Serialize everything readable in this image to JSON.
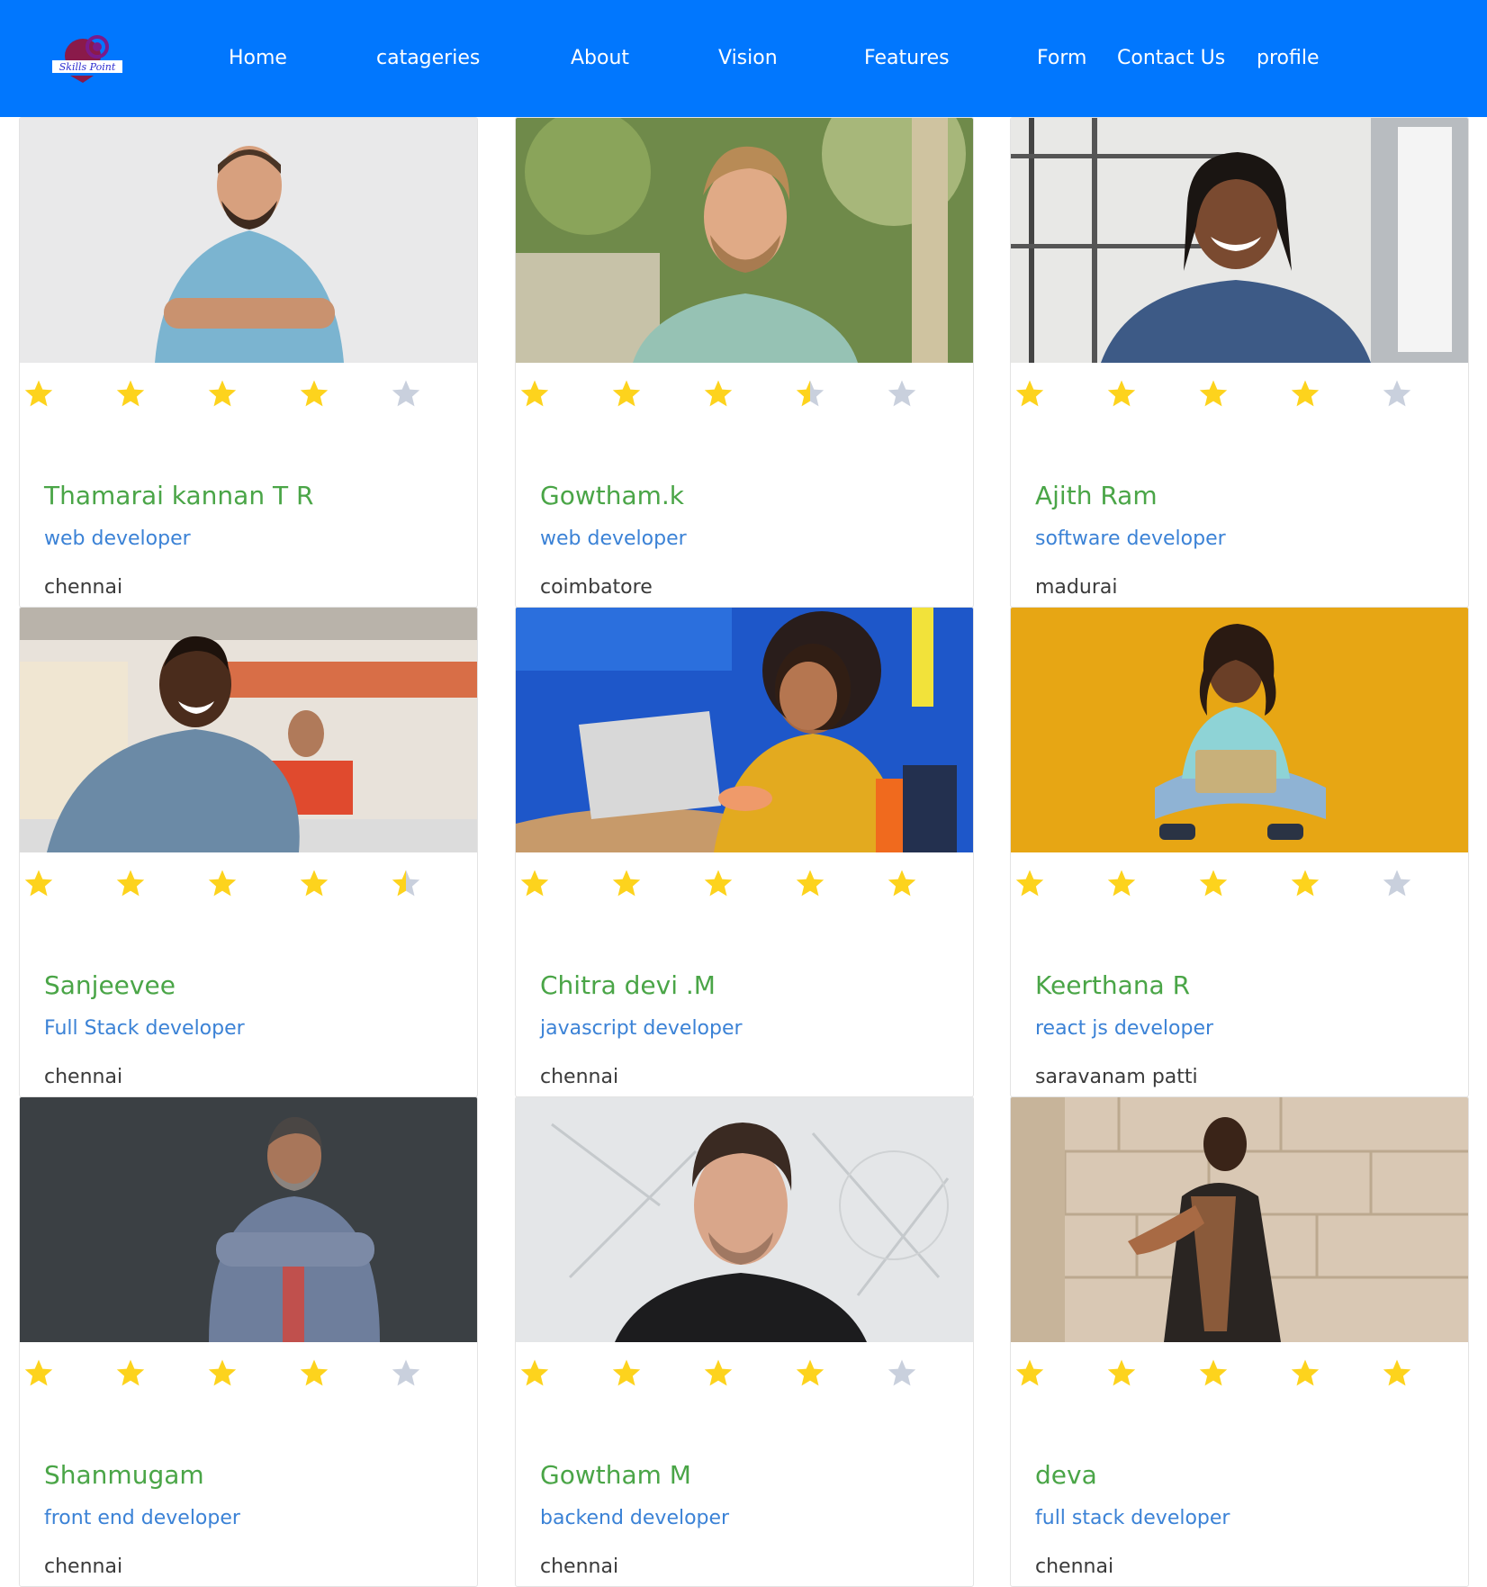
{
  "header": {
    "logo_text": "Skills Point",
    "nav": [
      {
        "label": "Home"
      },
      {
        "label": "catageries"
      },
      {
        "label": "About"
      },
      {
        "label": "Vision"
      },
      {
        "label": "Features"
      },
      {
        "label": "Form"
      },
      {
        "label": "Contact Us"
      },
      {
        "label": "profile"
      }
    ]
  },
  "colors": {
    "navbar": "#0177fe",
    "name": "#4aa547",
    "role": "#3b82d6",
    "city": "#3a3a3a",
    "star_filled": "#fdd31d",
    "star_empty": "#c9d0dd"
  },
  "profiles": [
    {
      "name": "Thamarai kannan T R",
      "role": "web developer",
      "city": "chennai",
      "rating": 4,
      "photo": "man-light-blue-shirt-arms-crossed"
    },
    {
      "name": "Gowtham.k",
      "role": "web developer",
      "city": "coimbatore",
      "rating": 3.5,
      "photo": "man-green-tshirt-outdoors"
    },
    {
      "name": "Ajith Ram",
      "role": "software developer",
      "city": "madurai",
      "rating": 4,
      "photo": "smiling-man-denim-jacket-window"
    },
    {
      "name": "Sanjeevee",
      "role": "Full Stack developer",
      "city": "chennai",
      "rating": 4.5,
      "photo": "student-denim-jacket-classroom"
    },
    {
      "name": "Chitra devi .M",
      "role": "javascript developer",
      "city": "chennai",
      "rating": 5,
      "photo": "woman-yellow-sweater-laptop-blue-wall"
    },
    {
      "name": "Keerthana R",
      "role": "react js developer",
      "city": "saravanam patti",
      "rating": 4,
      "photo": "woman-sitting-laptop-yellow-background"
    },
    {
      "name": "Shanmugam",
      "role": "front end developer",
      "city": "chennai",
      "rating": 4,
      "photo": "man-denim-shirt-dark-wall"
    },
    {
      "name": "Gowtham M",
      "role": "backend developer",
      "city": "chennai",
      "rating": 4,
      "photo": "man-black-shirt-portrait"
    },
    {
      "name": "deva",
      "role": "full stack developer",
      "city": "chennai",
      "rating": 5,
      "photo": "man-plaid-scarf-stone-wall"
    }
  ]
}
